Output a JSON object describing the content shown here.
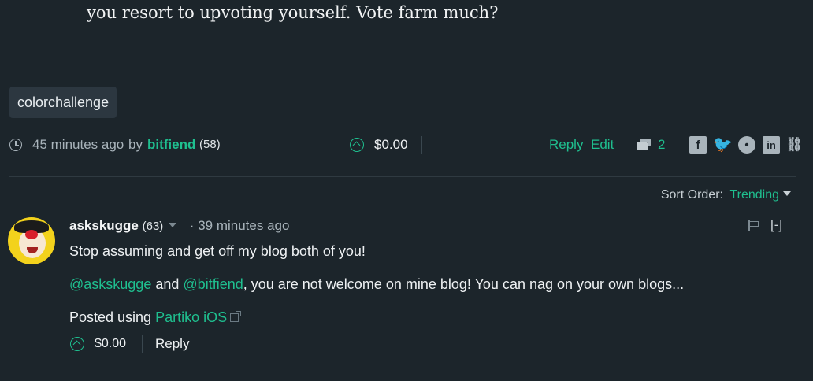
{
  "post": {
    "body_tail": "you resort to upvoting yourself. Vote farm much?",
    "tag": "colorchallenge",
    "time": "45 minutes ago",
    "by": "by",
    "author": "bitfiend",
    "author_rep": "(58)",
    "payout": "$0.00",
    "reply_label": "Reply",
    "edit_label": "Edit",
    "comment_count": "2",
    "share_icons": [
      "facebook-icon",
      "twitter-icon",
      "reddit-icon",
      "linkedin-icon",
      "link-icon"
    ]
  },
  "sort": {
    "label": "Sort Order:",
    "value": "Trending"
  },
  "comment": {
    "author": "askskugge",
    "author_rep": "(63)",
    "time": "39 minutes ago",
    "collapse_label": "[-]",
    "line1": "Stop assuming and get off my blog both of you!",
    "mention1": "@askskugge",
    "and_text": "and",
    "mention2": "@bitfiend",
    "line2_rest": ", you are not welcome on mine blog! You can nag on your own blogs...",
    "posted_using": "Posted using",
    "app_link": "Partiko iOS",
    "payout": "$0.00",
    "reply_label": "Reply"
  },
  "colors": {
    "background": "#1c252b",
    "accent": "#1fbf8f",
    "text": "#eef1f3",
    "muted": "#a9b4bb"
  }
}
